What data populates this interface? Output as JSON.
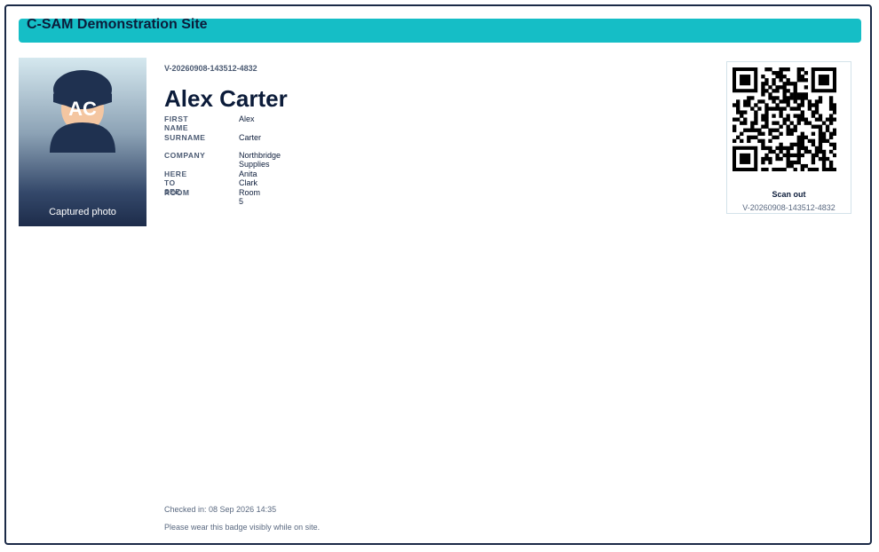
{
  "site": {
    "title": "C-SAM Demonstration Site",
    "accent_color": "#15bec6"
  },
  "visitor": {
    "id": "V-20260908-143512-4832",
    "display_name": "Alex Carter",
    "initials": "AC",
    "photo_caption": "Captured photo",
    "photo_icon": "person-silhouette-icon",
    "fields": [
      {
        "label": "FIRST NAME",
        "value": "Alex"
      },
      {
        "label": "SURNAME",
        "value": "Carter"
      },
      {
        "label": "COMPANY",
        "value": "Northbridge Supplies"
      },
      {
        "label": "HERE TO SEE",
        "value": "Anita Clark"
      },
      {
        "label": "ROOM",
        "value": "Room 5"
      }
    ]
  },
  "qr": {
    "label": "Scan out",
    "id": "V-20260908-143512-4832",
    "icon": "qr-code-icon"
  },
  "footer": {
    "checked_in": "Checked in: 08 Sep 2026 14:35",
    "notice": "Please wear this badge visibly while on site."
  }
}
